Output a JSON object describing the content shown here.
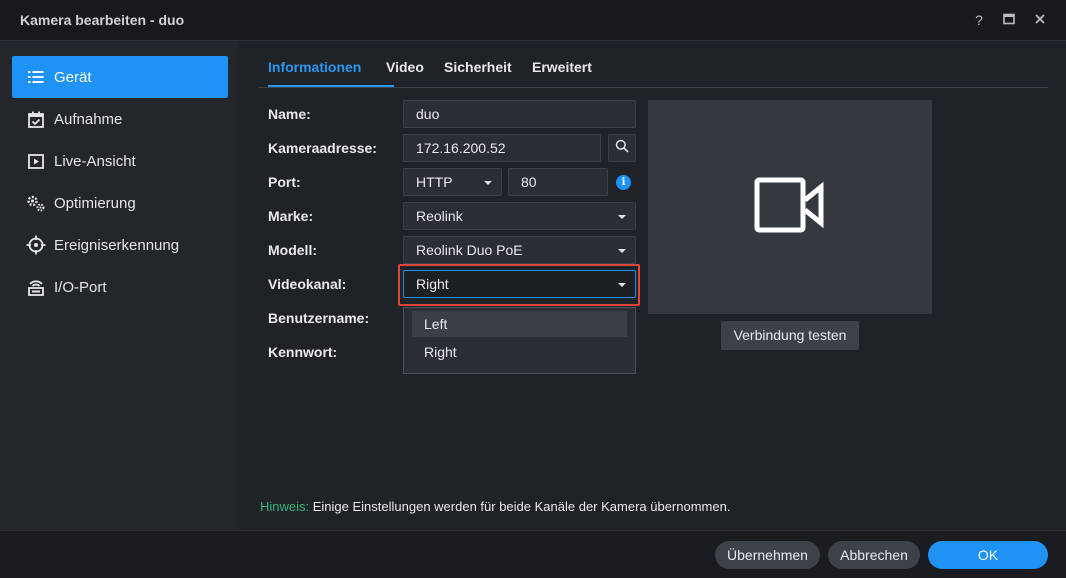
{
  "window": {
    "title": "Kamera bearbeiten - duo",
    "help_icon": "question-icon",
    "maximize_icon": "maximize-icon",
    "close_icon": "close-icon"
  },
  "sidebar": {
    "items": [
      {
        "label": "Gerät",
        "icon": "list-icon",
        "active": true
      },
      {
        "label": "Aufnahme",
        "icon": "calendar-check-icon"
      },
      {
        "label": "Live-Ansicht",
        "icon": "play-box-icon"
      },
      {
        "label": "Optimierung",
        "icon": "gears-icon"
      },
      {
        "label": "Ereigniserkennung",
        "icon": "crosshair-icon"
      },
      {
        "label": "I/O-Port",
        "icon": "io-port-icon"
      }
    ]
  },
  "tabs": [
    {
      "label": "Informationen",
      "active": true
    },
    {
      "label": "Video"
    },
    {
      "label": "Sicherheit"
    },
    {
      "label": "Erweitert"
    }
  ],
  "form": {
    "name": {
      "label": "Name:",
      "value": "duo"
    },
    "address": {
      "label": "Kameraadresse:",
      "value": "172.16.200.52"
    },
    "port": {
      "label": "Port:",
      "protocol": "HTTP",
      "value": "80"
    },
    "brand": {
      "label": "Marke:",
      "value": "Reolink"
    },
    "model": {
      "label": "Modell:",
      "value": "Reolink Duo PoE"
    },
    "channel": {
      "label": "Videokanal:",
      "value": "Right",
      "options": [
        "Left",
        "Right"
      ]
    },
    "username": {
      "label": "Benutzername:"
    },
    "password": {
      "label": "Kennwort:"
    }
  },
  "preview": {
    "icon": "video-camera-icon",
    "test_button": "Verbindung testen"
  },
  "hint": {
    "prefix": "Hinweis:",
    "text": "Einige Einstellungen werden für beide Kanäle der Kamera übernommen."
  },
  "footer": {
    "apply": "Übernehmen",
    "cancel": "Abbrechen",
    "ok": "OK"
  },
  "colors": {
    "accent": "#1e93f5",
    "hint_green": "#36b57a",
    "highlight_red": "#e0453a"
  }
}
